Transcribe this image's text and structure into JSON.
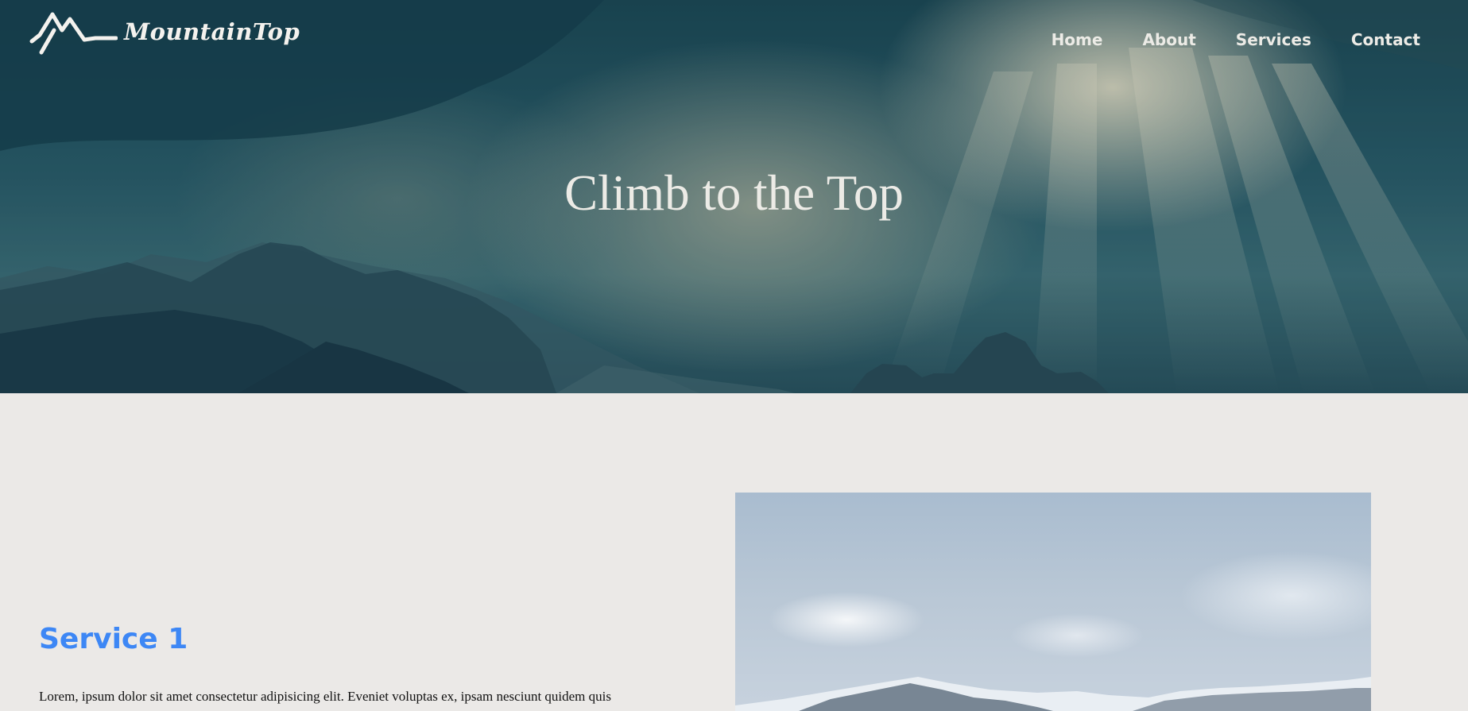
{
  "brand": {
    "name": "MountainTop"
  },
  "nav": {
    "items": [
      {
        "label": "Home"
      },
      {
        "label": "About"
      },
      {
        "label": "Services"
      },
      {
        "label": "Contact"
      }
    ]
  },
  "hero": {
    "title": "Climb to the Top"
  },
  "services": [
    {
      "heading": "Service 1",
      "text": "Lorem, ipsum dolor sit amet consectetur adipisicing elit. Eveniet voluptas ex, ipsam nesciunt quidem quis"
    }
  ],
  "colors": {
    "accent": "#3d87f5",
    "page_background": "#ebe9e7",
    "nav_text": "#ecebe6"
  }
}
